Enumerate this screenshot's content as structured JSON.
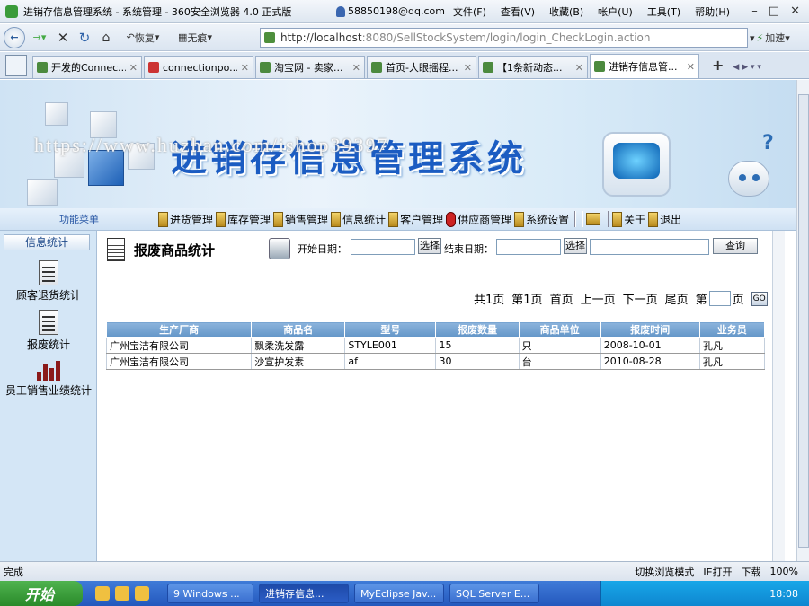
{
  "browser": {
    "title": "进销存信息管理系统 - 系统管理 - 360安全浏览器 4.0 正式版",
    "account": "58850198@qq.com",
    "menu": [
      "文件(F)",
      "查看(V)",
      "收藏(B)",
      "帐户(U)",
      "工具(T)",
      "帮助(H)"
    ],
    "restore_label": "恢复",
    "noshadow_label": "无痕",
    "address_host": "http://localhost",
    "address_rest": ":8080/SellStockSystem/login/login_CheckLogin.action",
    "accelerate_label": "加速",
    "tabs": [
      {
        "label": "开发的Connec..."
      },
      {
        "label": "connectionpo..."
      },
      {
        "label": "淘宝网 - 卖家..."
      },
      {
        "label": "首页-大眼摇程..."
      },
      {
        "label": "【1条新动态..."
      },
      {
        "label": "进销存信息管..."
      }
    ]
  },
  "banner": {
    "headline": "进销存信息管理系统",
    "watermark": "https://www.huzhan.com/ishop39397"
  },
  "nav": {
    "function_menu": "功能菜单",
    "items": [
      "进货管理",
      "库存管理",
      "销售管理",
      "信息统计",
      "客户管理",
      "供应商管理",
      "系统设置"
    ],
    "about": "关于",
    "logout": "退出"
  },
  "sidebar": {
    "header": "信息统计",
    "items": [
      "顾客退货统计",
      "报废统计",
      "员工销售业绩统计"
    ]
  },
  "main": {
    "title": "报废商品统计",
    "start_date_label": "开始日期：",
    "end_date_label": "结束日期：",
    "select_label": "选择",
    "query_label": "查询",
    "pager": {
      "total": "共1页",
      "current": "第1页",
      "first": "首页",
      "prev": "上一页",
      "next": "下一页",
      "last": "尾页",
      "goto_prefix": "第",
      "goto_suffix": "页",
      "go": "GO"
    },
    "table": {
      "headers": [
        "生产厂商",
        "商品名",
        "型号",
        "报废数量",
        "商品单位",
        "报废时间",
        "业务员"
      ],
      "rows": [
        [
          "广州宝洁有限公司",
          "飘柔洗发露",
          "STYLE001",
          "15",
          "只",
          "2008-10-01",
          "孔凡"
        ],
        [
          "广州宝洁有限公司",
          "沙宣护发素",
          "af",
          "30",
          "台",
          "2010-08-28",
          "孔凡"
        ]
      ]
    }
  },
  "statusbar": {
    "left": "完成",
    "switch_mode": "切换浏览模式",
    "ie_open": "IE打开",
    "download": "下载",
    "zoom": "100%"
  },
  "taskbar": {
    "start": "开始",
    "tasks": [
      "9 Windows ...",
      "进销存信息...",
      "MyEclipse Jav...",
      "SQL Server E..."
    ],
    "clock": "18:08"
  }
}
